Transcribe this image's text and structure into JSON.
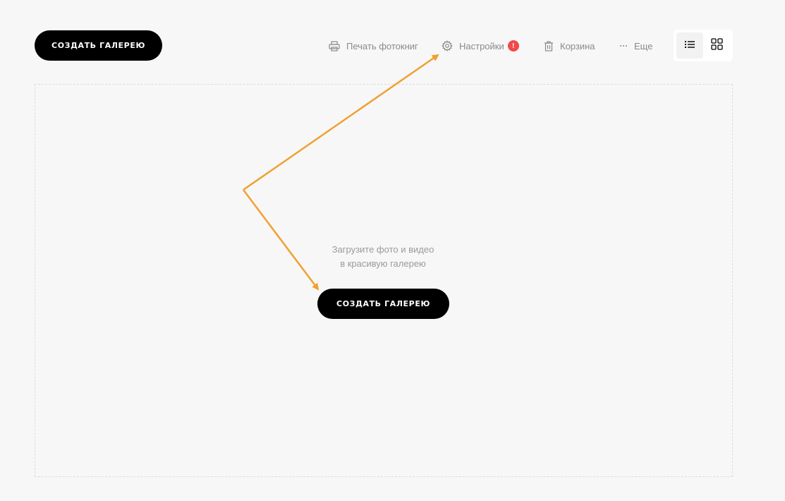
{
  "header": {
    "create_label": "СОЗДАТЬ ГАЛЕРЕЮ"
  },
  "toolbar": {
    "print_label": "Печать фотокниг",
    "print_icon": "printer-icon",
    "settings_label": "Настройки",
    "settings_icon": "gear-icon",
    "settings_badge": "!",
    "trash_label": "Корзина",
    "trash_icon": "trash-icon",
    "more_label": "Еще",
    "more_icon": "ellipsis-icon"
  },
  "view_toggle": {
    "options": [
      "list-view",
      "grid-view"
    ],
    "active": "list-view"
  },
  "empty_state": {
    "line1": "Загрузите фото и видео",
    "line2": "в красивую галерею",
    "create_label": "СОЗДАТЬ ГАЛЕРЕЮ"
  },
  "colors": {
    "background": "#f7f7f7",
    "primary_button": "#000000",
    "badge": "#f04a4a",
    "annotation_arrow": "#f0a030",
    "muted_text": "#8a8a8a"
  }
}
